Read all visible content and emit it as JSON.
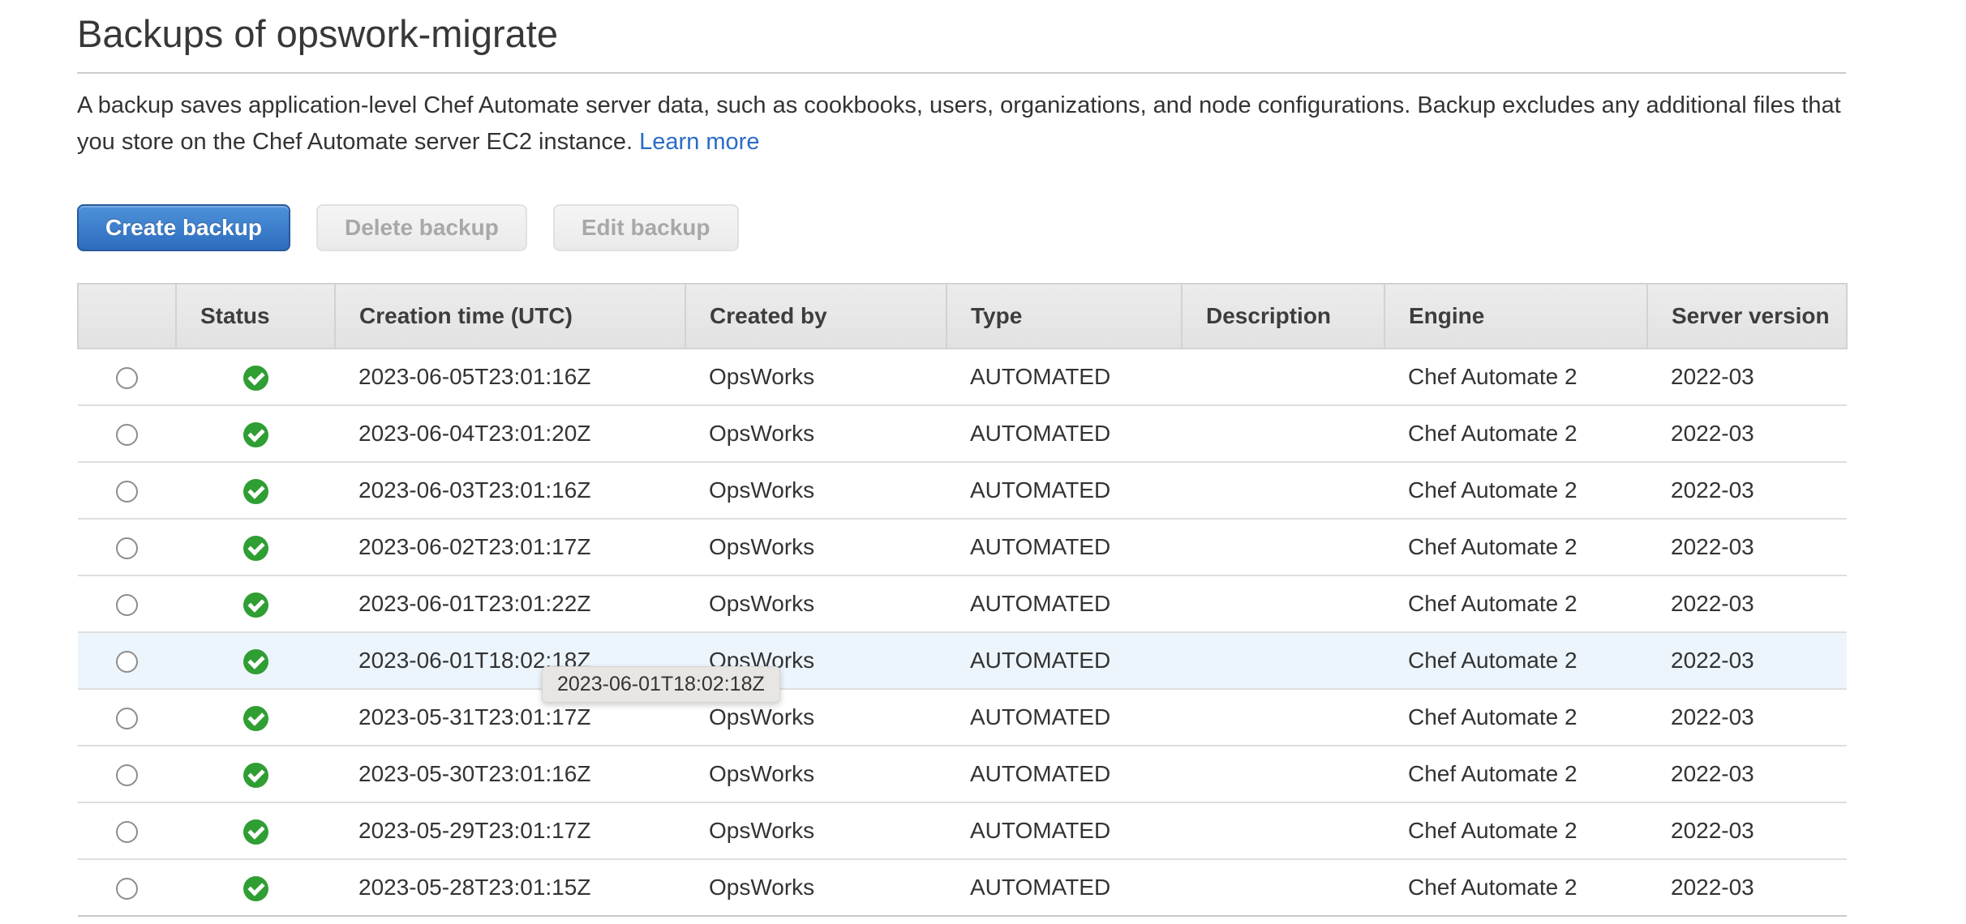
{
  "page": {
    "title": "Backups of opswork-migrate",
    "description": "A backup saves application-level Chef Automate server data, such as cookbooks, users, organizations, and node configurations. Backup excludes any additional files that you store on the Chef Automate server EC2 instance.",
    "learn_more_label": "Learn more"
  },
  "toolbar": {
    "create_label": "Create backup",
    "delete_label": "Delete backup",
    "edit_label": "Edit backup"
  },
  "table": {
    "columns": [
      "",
      "Status",
      "Creation time (UTC)",
      "Created by",
      "Type",
      "Description",
      "Engine",
      "Server version"
    ],
    "rows": [
      {
        "status": "ok",
        "creation_time": "2023-06-05T23:01:16Z",
        "created_by": "OpsWorks",
        "type": "AUTOMATED",
        "description": "",
        "engine": "Chef Automate 2",
        "server_version": "2022-03",
        "highlighted": false
      },
      {
        "status": "ok",
        "creation_time": "2023-06-04T23:01:20Z",
        "created_by": "OpsWorks",
        "type": "AUTOMATED",
        "description": "",
        "engine": "Chef Automate 2",
        "server_version": "2022-03",
        "highlighted": false
      },
      {
        "status": "ok",
        "creation_time": "2023-06-03T23:01:16Z",
        "created_by": "OpsWorks",
        "type": "AUTOMATED",
        "description": "",
        "engine": "Chef Automate 2",
        "server_version": "2022-03",
        "highlighted": false
      },
      {
        "status": "ok",
        "creation_time": "2023-06-02T23:01:17Z",
        "created_by": "OpsWorks",
        "type": "AUTOMATED",
        "description": "",
        "engine": "Chef Automate 2",
        "server_version": "2022-03",
        "highlighted": false
      },
      {
        "status": "ok",
        "creation_time": "2023-06-01T23:01:22Z",
        "created_by": "OpsWorks",
        "type": "AUTOMATED",
        "description": "",
        "engine": "Chef Automate 2",
        "server_version": "2022-03",
        "highlighted": false
      },
      {
        "status": "ok",
        "creation_time": "2023-06-01T18:02:18Z",
        "created_by": "OpsWorks",
        "type": "AUTOMATED",
        "description": "",
        "engine": "Chef Automate 2",
        "server_version": "2022-03",
        "highlighted": true
      },
      {
        "status": "ok",
        "creation_time": "2023-05-31T23:01:17Z",
        "created_by": "OpsWorks",
        "type": "AUTOMATED",
        "description": "",
        "engine": "Chef Automate 2",
        "server_version": "2022-03",
        "highlighted": false
      },
      {
        "status": "ok",
        "creation_time": "2023-05-30T23:01:16Z",
        "created_by": "OpsWorks",
        "type": "AUTOMATED",
        "description": "",
        "engine": "Chef Automate 2",
        "server_version": "2022-03",
        "highlighted": false
      },
      {
        "status": "ok",
        "creation_time": "2023-05-29T23:01:17Z",
        "created_by": "OpsWorks",
        "type": "AUTOMATED",
        "description": "",
        "engine": "Chef Automate 2",
        "server_version": "2022-03",
        "highlighted": false
      },
      {
        "status": "ok",
        "creation_time": "2023-05-28T23:01:15Z",
        "created_by": "OpsWorks",
        "type": "AUTOMATED",
        "description": "",
        "engine": "Chef Automate 2",
        "server_version": "2022-03",
        "highlighted": false
      }
    ]
  },
  "tooltip": {
    "text": "2023-06-01T18:02:18Z"
  },
  "icons": {
    "status_ok": "green-circle-check-icon",
    "row_selector": "radio-icon"
  },
  "colors": {
    "primary_button_blue": "#3579c8",
    "link_blue": "#2a6bc5",
    "status_green": "#2f9e33",
    "row_highlight": "#edf5fc",
    "tooltip_bg": "#e8e6e3",
    "header_bg": "#e7e7e7"
  }
}
